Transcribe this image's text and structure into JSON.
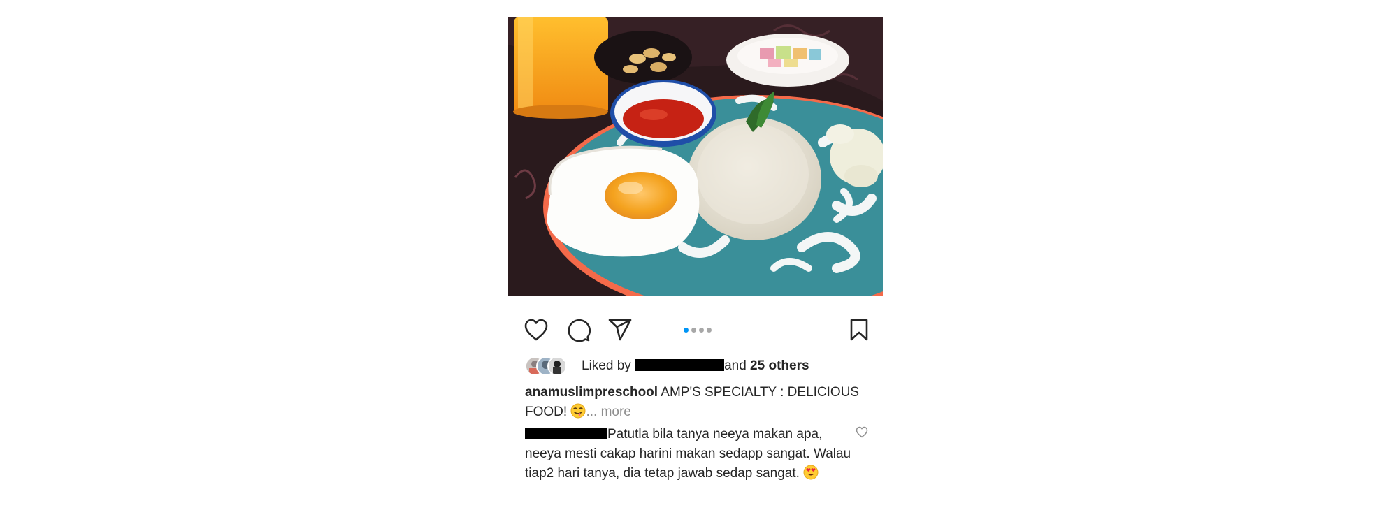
{
  "post": {
    "photo_alt": "Plate of rice, fried egg, sambal with orange drink",
    "carousel": {
      "total": 4,
      "active_index": 0
    },
    "actions": {
      "like_icon": "heart-icon",
      "comment_icon": "comment-icon",
      "share_icon": "paper-plane-icon",
      "save_icon": "bookmark-icon"
    },
    "likes": {
      "prefix": "Liked by",
      "connector": "and",
      "others": "25 others"
    },
    "caption": {
      "username": "anamuslimpreschool",
      "text": "AMP'S SPECIALTY : DELICIOUS FOOD!",
      "emoji": "drooling-face",
      "more": "... more"
    },
    "comment": {
      "text": "Patutla bila tanya neeya makan apa, neeya mesti cakap harini makan sedapp sangat. Walau tiap2 hari tanya, dia tetap jawab sedap sangat.",
      "emoji": "heart-eyes-face",
      "like_icon": "small-heart-icon"
    }
  },
  "colors": {
    "text": "#262626",
    "muted": "#8e8e8e",
    "accent": "#0095f6"
  }
}
